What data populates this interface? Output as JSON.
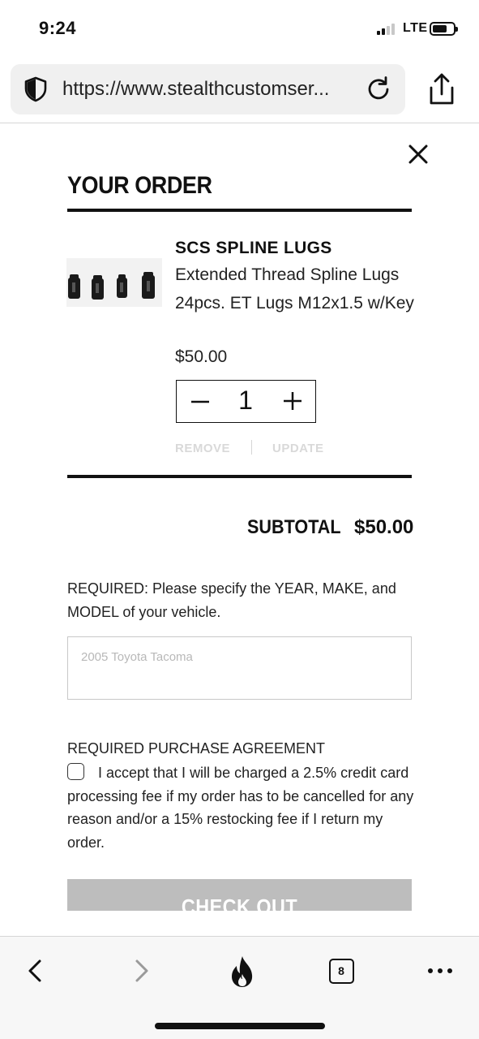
{
  "status_bar": {
    "time": "9:24",
    "network": "LTE",
    "signal_bars_active": 2,
    "signal_bars_total": 4,
    "battery_level": 0.7
  },
  "browser": {
    "url": "https://www.stealthcustomser...",
    "icons": [
      "shield-icon",
      "reload-icon",
      "share-icon"
    ]
  },
  "order": {
    "title": "YOUR ORDER",
    "item": {
      "name": "SCS SPLINE LUGS",
      "description": "Extended Thread Spline Lugs 24pcs. ET Lugs M12x1.5 w/Key",
      "price": "$50.00",
      "quantity": "1",
      "remove_label": "REMOVE",
      "update_label": "UPDATE"
    },
    "subtotal_label": "SUBTOTAL",
    "subtotal_value": "$50.00",
    "vehicle_note": "REQUIRED: Please specify the YEAR, MAKE, and MODEL of your vehicle.",
    "vehicle_placeholder": "2005 Toyota Tacoma",
    "agreement_heading": "REQUIRED PURCHASE AGREEMENT",
    "agreement_text": "I accept that I will be charged a 2.5% credit card processing fee if my order has to be cancelled for any reason and/or a 15% restocking fee if I return my order.",
    "checkout_label": "CHECK OUT"
  },
  "toolbar": {
    "tab_count": "8",
    "icons": [
      "back-icon",
      "forward-icon",
      "fire-icon",
      "tabs-icon",
      "more-icon"
    ]
  },
  "colors": {
    "text": "#111111",
    "muted_link": "#d9d9d9",
    "checkout_bg": "#bdbdbd",
    "url_bar_bg": "#f0f0f0",
    "toolbar_bg": "#f7f7f7"
  }
}
